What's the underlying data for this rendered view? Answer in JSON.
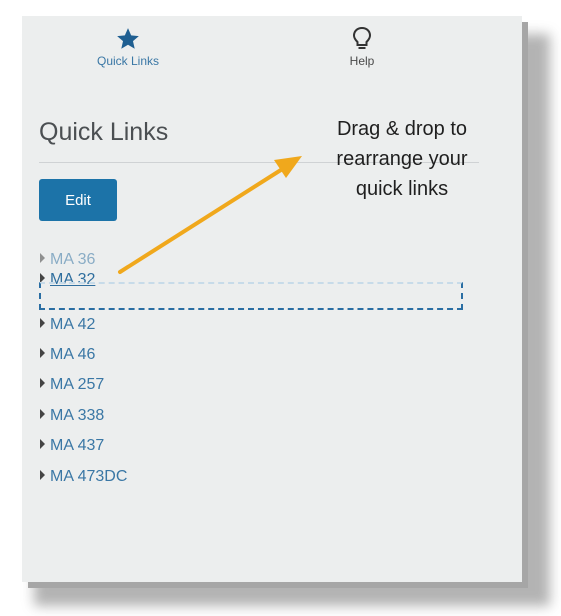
{
  "topnav": {
    "items": [
      {
        "label": "Quick Links",
        "icon": "star-icon"
      },
      {
        "label": "Help",
        "icon": "lightbulb-icon"
      }
    ]
  },
  "section": {
    "title": "Quick Links",
    "edit_label": "Edit"
  },
  "links": {
    "ghost": "MA 36",
    "dragging": "MA 32",
    "items": [
      "MA 42",
      "MA 46",
      "MA 257",
      "MA 338",
      "MA 437",
      "MA 473DC"
    ]
  },
  "callout": {
    "lines": [
      "Drag & drop to",
      "rearrange your",
      "quick links"
    ]
  },
  "colors": {
    "accent": "#1c73a8",
    "link": "#3a77a5",
    "arrow": "#f0a81c"
  }
}
